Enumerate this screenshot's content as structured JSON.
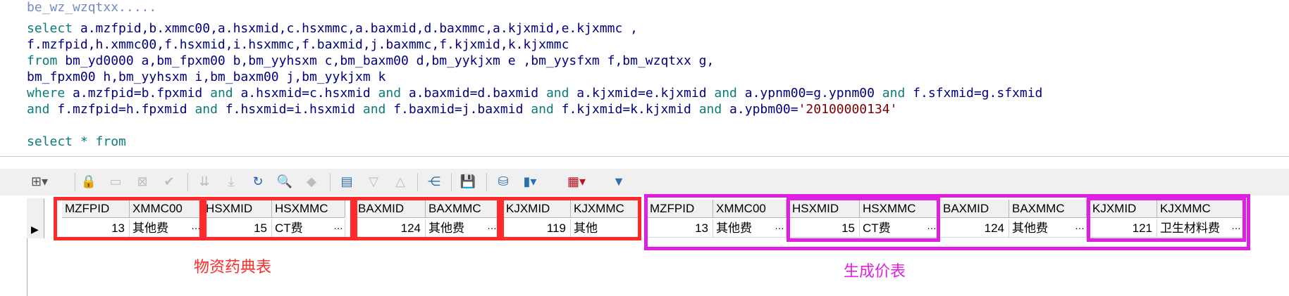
{
  "editor": {
    "lines": [
      "select a.mzfpid,b.xmmc00,a.hsxmid,c.hsxmmc,a.baxmid,d.baxmmc,a.kjxmid,e.kjxmmc ,",
      "f.mzfpid,h.xmmc00,f.hsxmid,i.hsxmmc,f.baxmid,j.baxmmc,f.kjxmid,k.kjxmmc",
      "from bm_yd0000 a,bm_fpxm00 b,bm_yyhsxm c,bm_baxm00 d,bm_yykjxm e ,bm_yysfxm f,bm_wzqtxx g,",
      "bm_fpxm00 h,bm_yyhsxm i,bm_baxm00 j,bm_yykjxm k",
      "where a.mzfpid=b.fpxmid and a.hsxmid=c.hsxmid and a.baxmid=d.baxmid and a.kjxmid=e.kjxmid and a.ypnm00=g.ypnm00 and f.sfxmid=g.sfxmid",
      "and f.mzfpid=h.fpxmid and f.hsxmid=i.hsxmid and f.baxmid=j.baxmid and f.kjxmid=k.kjxmid and a.ypbm00='20100000134'",
      "select * from"
    ]
  },
  "toolbar": {
    "icons": [
      "grid-options-icon",
      "lock-icon",
      "new-row-icon",
      "delete-row-icon",
      "confirm-icon",
      "move-down-icon",
      "move-last-icon",
      "refresh-icon",
      "find-icon",
      "clear-icon",
      "import-icon",
      "sort-desc-icon",
      "sort-asc-icon",
      "tree-icon",
      "save-icon",
      "database-icon",
      "chart-icon",
      "table-icon",
      "filter-icon"
    ]
  },
  "grid": {
    "columns": [
      "MZFPID",
      "XMMC00",
      "HSXMID",
      "HSXMMC",
      "BAXMID",
      "BAXMMC",
      "KJXMID",
      "KJXMMC",
      "MZFPID",
      "XMMC00",
      "HSXMID",
      "HSXMMC",
      "BAXMID",
      "BAXMMC",
      "KJXMID",
      "KJXMMC"
    ],
    "row": [
      "13",
      "其他费",
      "15",
      "CT费",
      "124",
      "其他费",
      "119",
      "其他",
      "13",
      "其他费",
      "15",
      "CT费",
      "124",
      "其他费",
      "121",
      "卫生材料费"
    ],
    "row_indicator": "▶"
  },
  "annotations": {
    "left_label": "物资药典表",
    "right_label": "生成价表",
    "colors": {
      "red": "#ff2a2a",
      "magenta": "#e020e0"
    }
  }
}
